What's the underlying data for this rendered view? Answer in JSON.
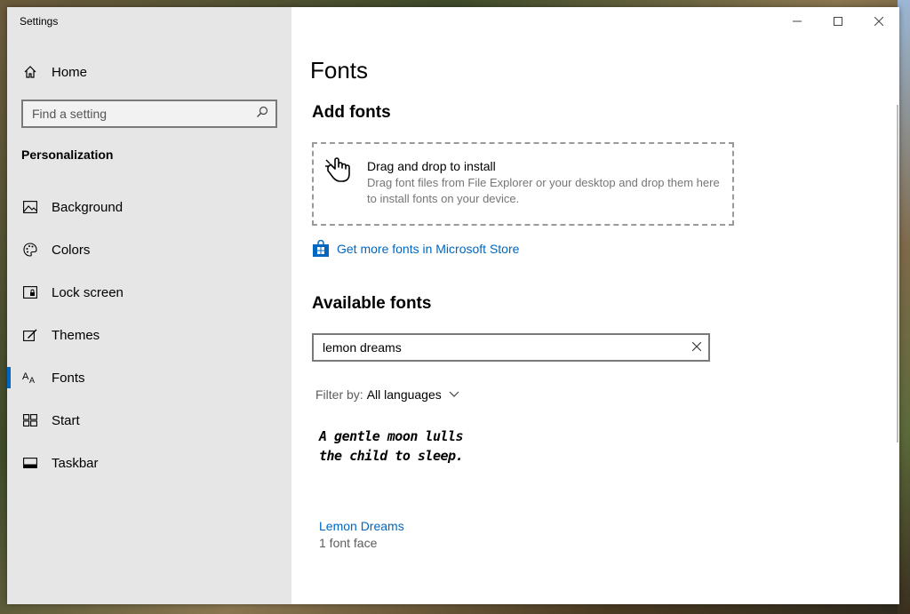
{
  "window": {
    "title": "Settings"
  },
  "sidebar": {
    "home_label": "Home",
    "search_placeholder": "Find a setting",
    "section_label": "Personalization",
    "items": [
      {
        "label": "Background",
        "icon": "image-icon"
      },
      {
        "label": "Colors",
        "icon": "palette-icon"
      },
      {
        "label": "Lock screen",
        "icon": "lock-screen-icon"
      },
      {
        "label": "Themes",
        "icon": "themes-icon"
      },
      {
        "label": "Fonts",
        "icon": "fonts-icon",
        "selected": true
      },
      {
        "label": "Start",
        "icon": "start-icon"
      },
      {
        "label": "Taskbar",
        "icon": "taskbar-icon"
      }
    ]
  },
  "main": {
    "page_title": "Fonts",
    "add_fonts": {
      "heading": "Add fonts",
      "drop_title": "Drag and drop to install",
      "drop_description": "Drag font files from File Explorer or your desktop and drop them here to install fonts on your device.",
      "store_link": "Get more fonts in Microsoft Store"
    },
    "available_fonts": {
      "heading": "Available fonts",
      "search_value": "lemon dreams",
      "filter_label": "Filter by:",
      "filter_value": "All languages",
      "results": [
        {
          "preview_line1": "A gentle moon lulls",
          "preview_line2": "the child to sleep.",
          "name": "Lemon Dreams",
          "faces": "1 font face"
        }
      ]
    }
  },
  "colors": {
    "accent": "#0067c0",
    "sidebar_bg": "#e6e6e6"
  }
}
